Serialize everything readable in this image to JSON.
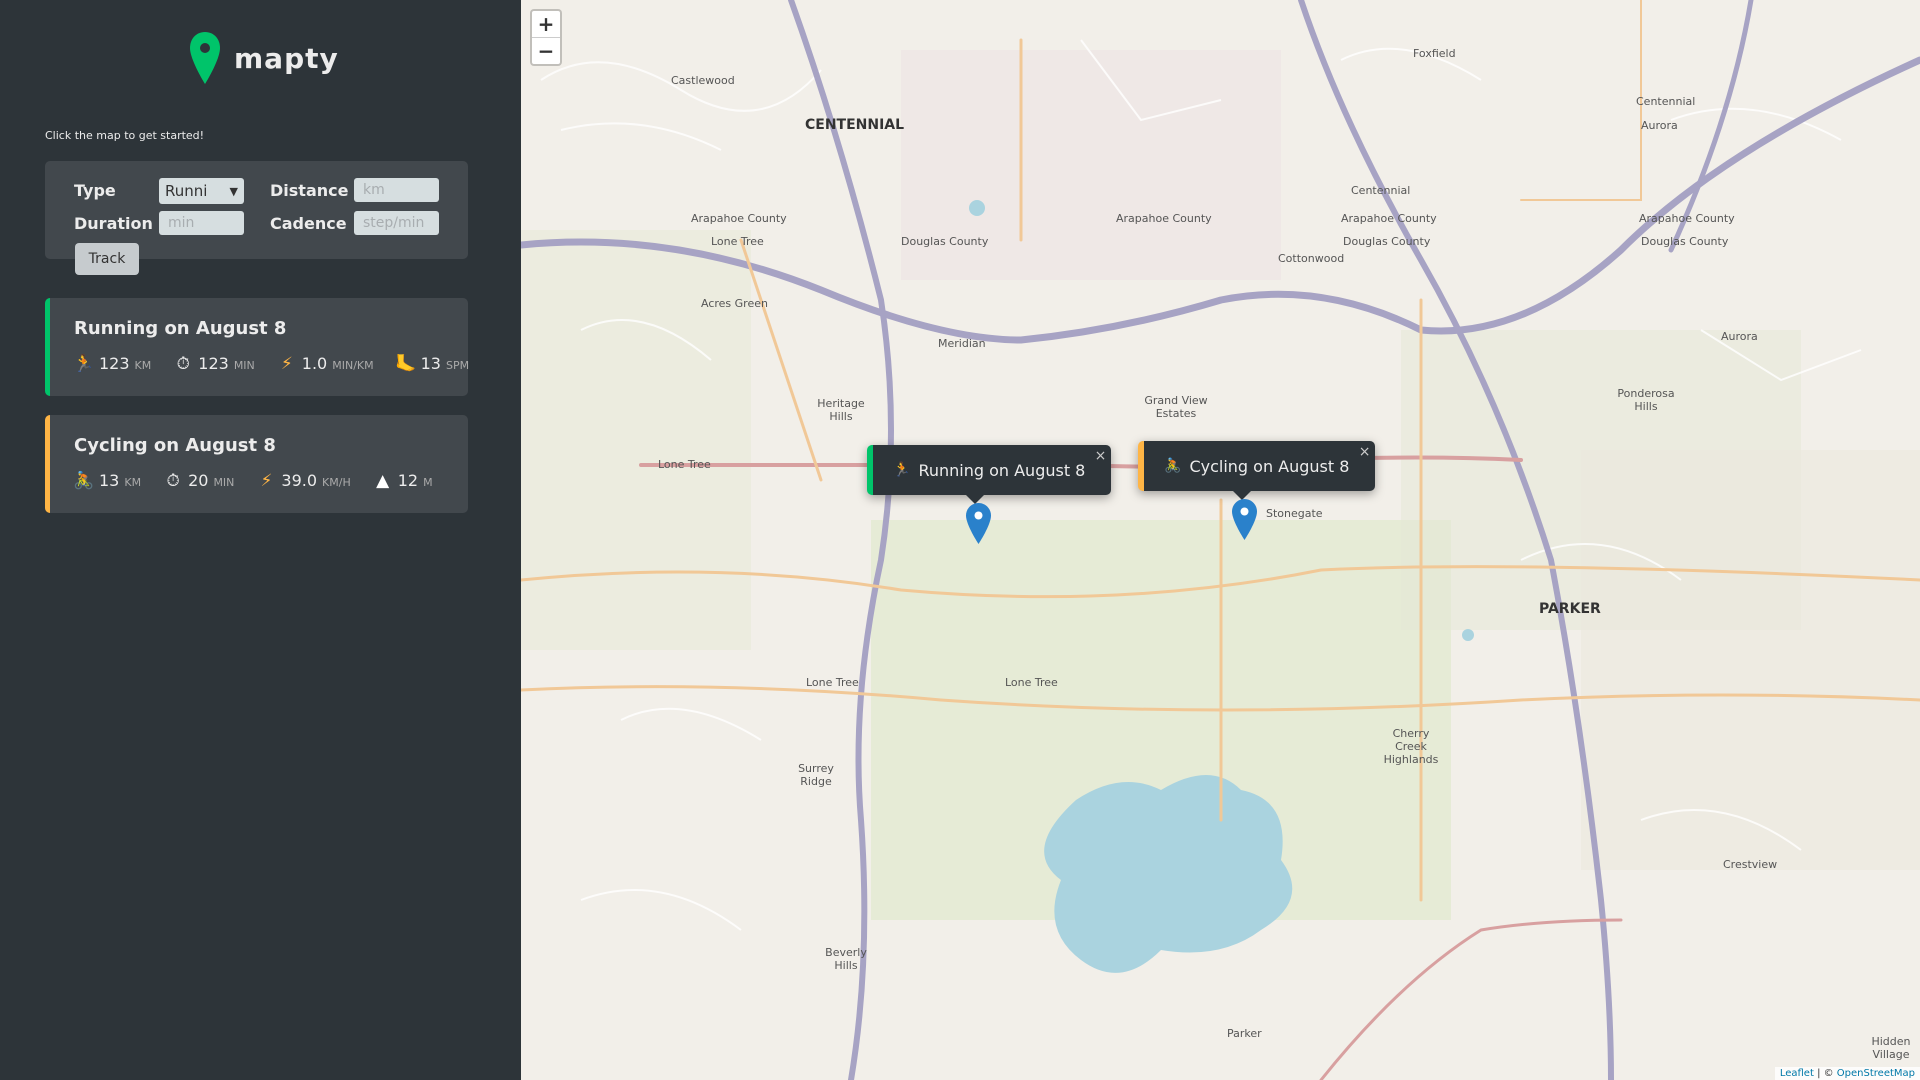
{
  "app": {
    "name": "mapty",
    "hint": "Click the map to get started!"
  },
  "form": {
    "type_label": "Type",
    "type_value": "Runni",
    "distance_label": "Distance",
    "distance_placeholder": "km",
    "duration_label": "Duration",
    "duration_placeholder": "min",
    "cadence_label": "Cadence",
    "cadence_placeholder": "step/min",
    "submit_label": "Track"
  },
  "workouts": [
    {
      "title": "Running on August 8",
      "type": "running",
      "color": "#00c46a",
      "details": [
        {
          "icon": "running-icon",
          "value": "123",
          "unit": "km"
        },
        {
          "icon": "stopwatch-icon",
          "value": "123",
          "unit": "min"
        },
        {
          "icon": "lightning-icon",
          "value": "1.0",
          "unit": "min/km"
        },
        {
          "icon": "footprint-icon",
          "value": "13",
          "unit": "spm"
        }
      ]
    },
    {
      "title": "Cycling on August 8",
      "type": "cycling",
      "color": "#ffb545",
      "details": [
        {
          "icon": "bicycle-icon",
          "value": "13",
          "unit": "km"
        },
        {
          "icon": "stopwatch-icon",
          "value": "20",
          "unit": "min"
        },
        {
          "icon": "lightning-icon",
          "value": "39.0",
          "unit": "km/h"
        },
        {
          "icon": "mountain-icon",
          "value": "12",
          "unit": "m"
        }
      ]
    }
  ],
  "map": {
    "zoom_in": "+",
    "zoom_out": "−",
    "popups": [
      {
        "text": "Running on August 8",
        "icon": "running-icon",
        "close": "×"
      },
      {
        "text": "Cycling on August 8",
        "icon": "bicycle-icon",
        "close": "×"
      }
    ],
    "places": [
      {
        "name": "Castlewood"
      },
      {
        "name": "CENTENNIAL",
        "big": true
      },
      {
        "name": "Foxfield"
      },
      {
        "name": "Centennial"
      },
      {
        "name": "Aurora"
      },
      {
        "name": "Centennial"
      },
      {
        "name": "Arapahoe County"
      },
      {
        "name": "Arapahoe County"
      },
      {
        "name": "Arapahoe County"
      },
      {
        "name": "Arapahoe County"
      },
      {
        "name": "Douglas County"
      },
      {
        "name": "Douglas County"
      },
      {
        "name": "Douglas County"
      },
      {
        "name": "Lone Tree"
      },
      {
        "name": "Cottonwood"
      },
      {
        "name": "Acres Green"
      },
      {
        "name": "Meridian"
      },
      {
        "name": "Aurora"
      },
      {
        "name": "Heritage Hills"
      },
      {
        "name": "Grand View Estates"
      },
      {
        "name": "Ponderosa Hills"
      },
      {
        "name": "Lone Tree"
      },
      {
        "name": "Stonegate"
      },
      {
        "name": "PARKER",
        "big": true
      },
      {
        "name": "Lone Tree"
      },
      {
        "name": "Lone Tree"
      },
      {
        "name": "Surrey Ridge"
      },
      {
        "name": "Cherry Creek Highlands"
      },
      {
        "name": "Crestview"
      },
      {
        "name": "Beverly Hills"
      },
      {
        "name": "Parker"
      },
      {
        "name": "Hidden Village"
      }
    ],
    "attribution_prefix": "Leaflet",
    "attribution_sep": " | © ",
    "attribution_link": "OpenStreetMap"
  }
}
